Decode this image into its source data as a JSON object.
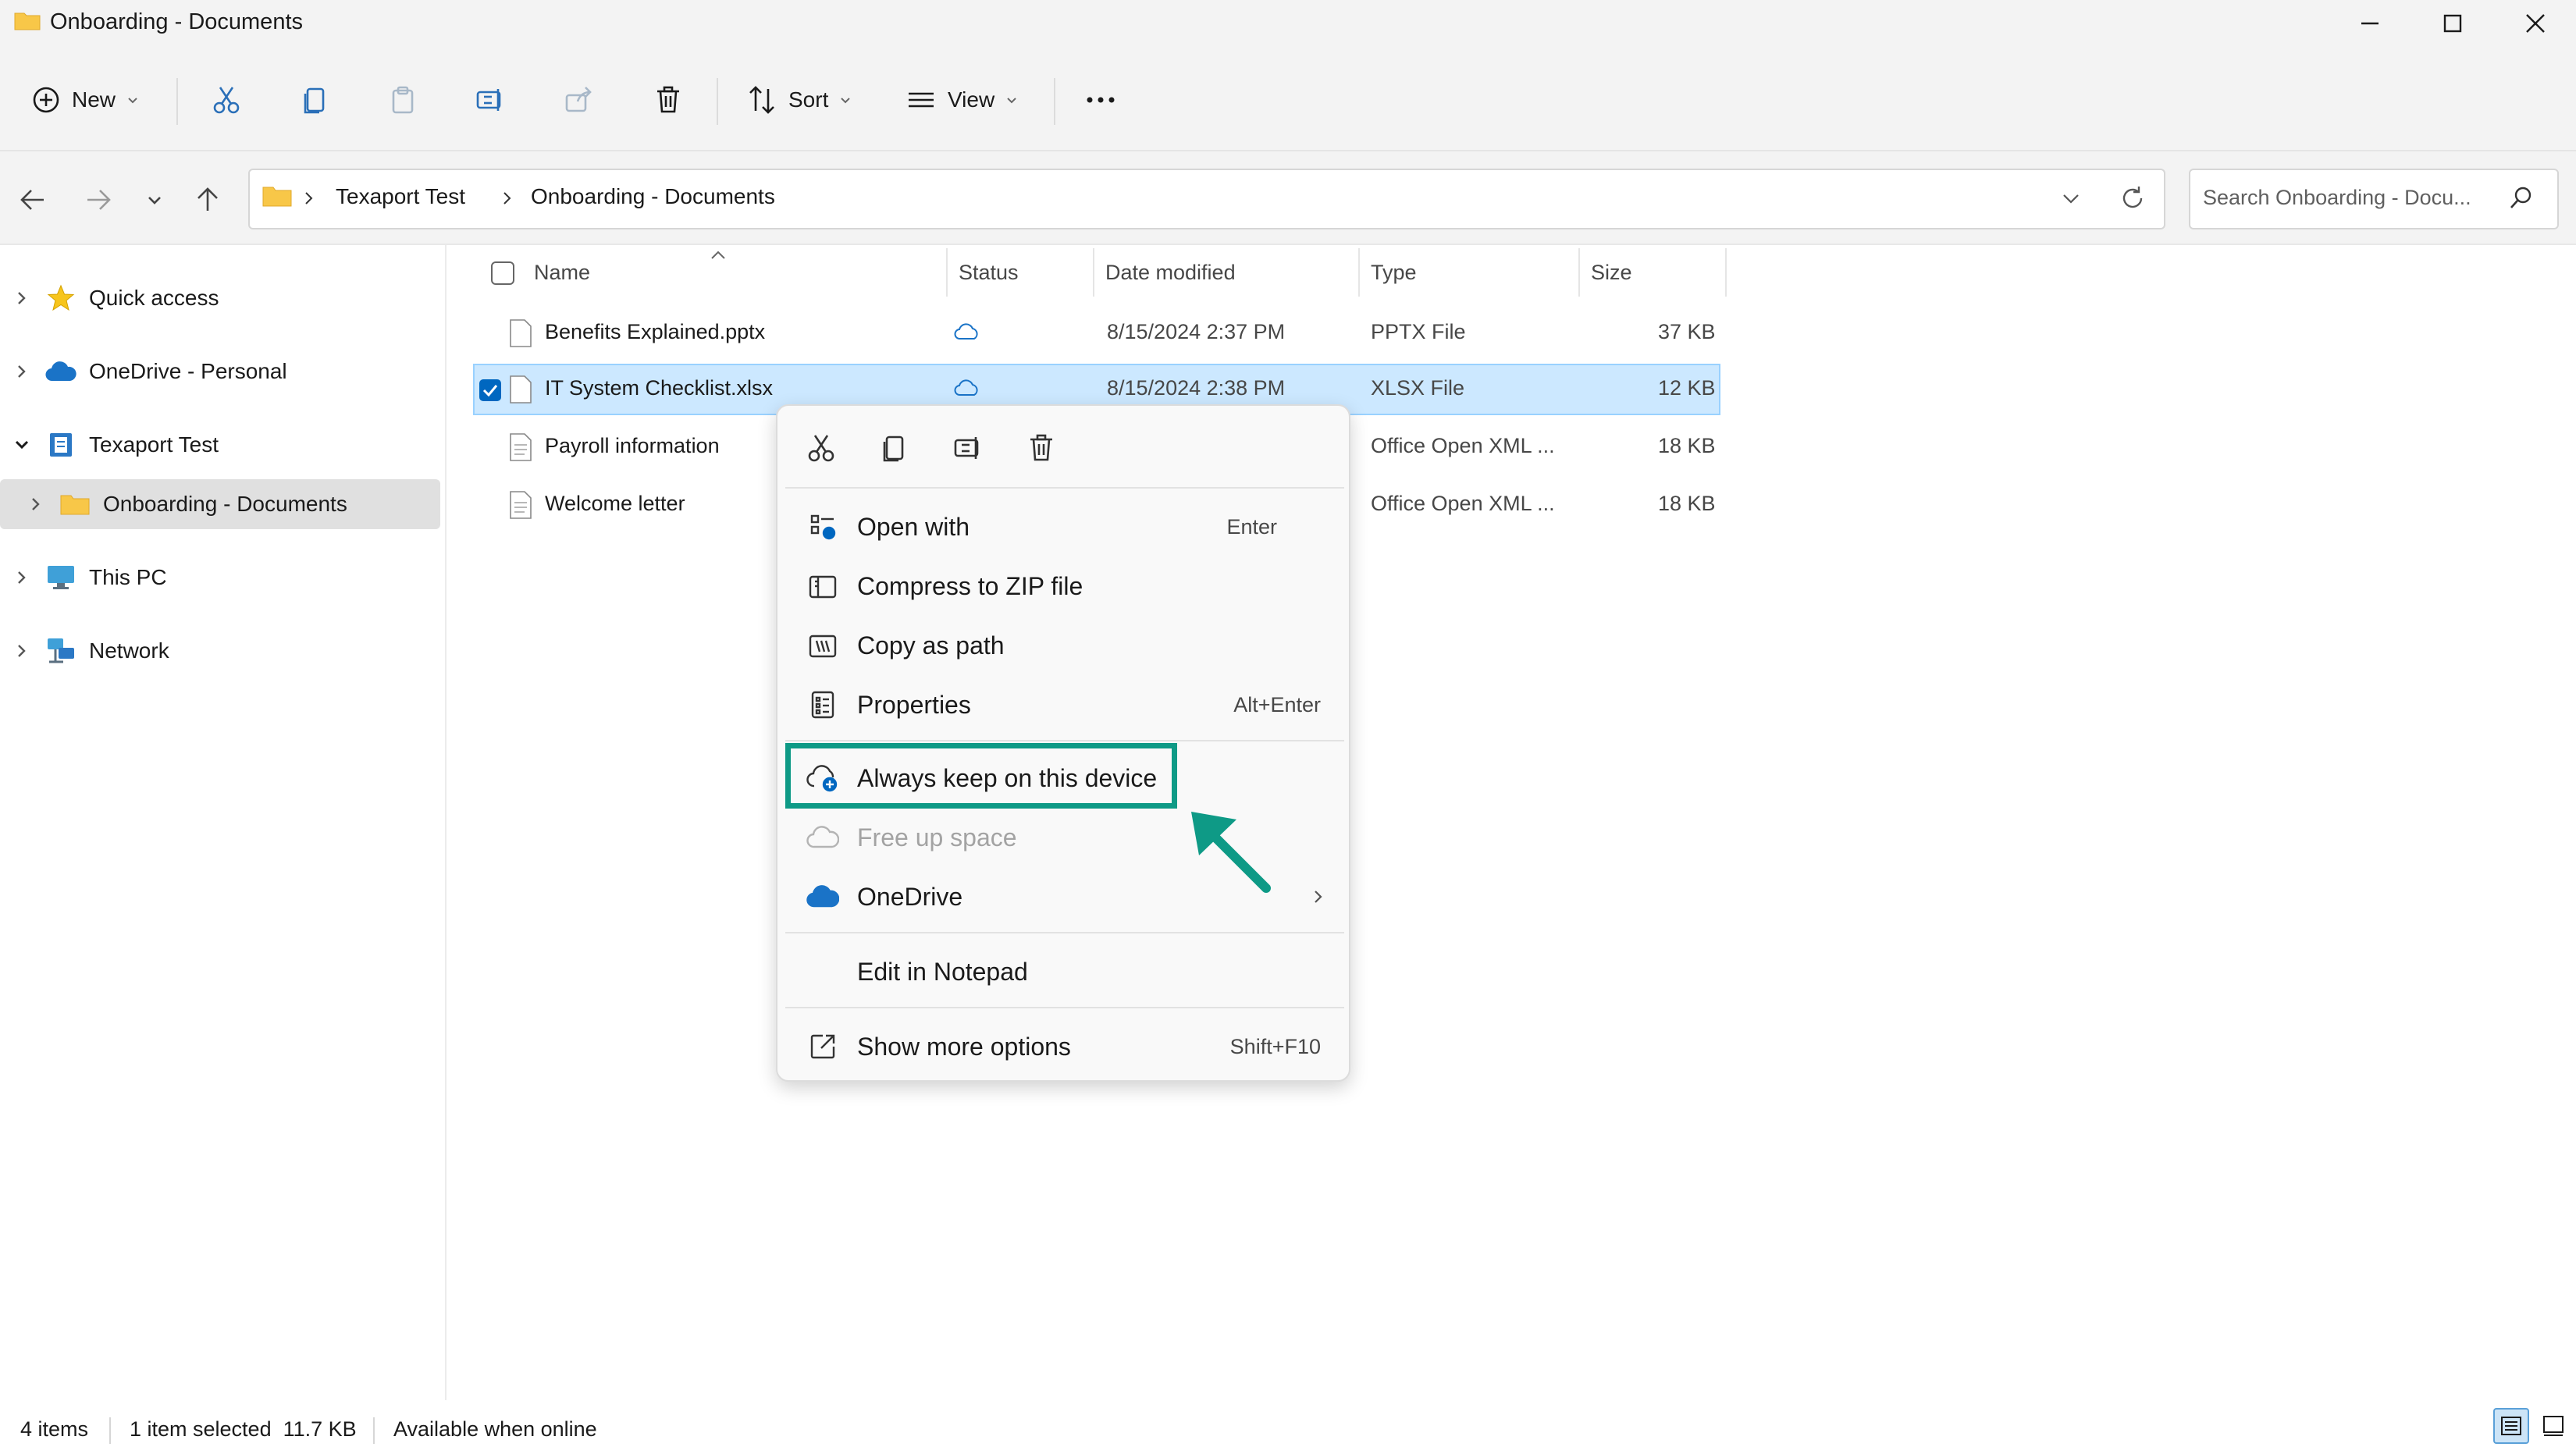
{
  "window": {
    "title": "Onboarding - Documents"
  },
  "toolbar": {
    "new_label": "New",
    "sort_label": "Sort",
    "view_label": "View"
  },
  "address": {
    "crumbs": [
      "Texaport Test",
      "Onboarding - Documents"
    ],
    "search_placeholder": "Search Onboarding - Docu..."
  },
  "sidebar": {
    "items": [
      {
        "label": "Quick access",
        "icon": "star-icon"
      },
      {
        "label": "OneDrive - Personal",
        "icon": "cloud-icon"
      },
      {
        "label": "Texaport Test",
        "icon": "library-icon"
      },
      {
        "label": "Onboarding - Documents",
        "icon": "folder-icon"
      },
      {
        "label": "This PC",
        "icon": "computer-icon"
      },
      {
        "label": "Network",
        "icon": "network-icon"
      }
    ]
  },
  "columns": [
    "Name",
    "Status",
    "Date modified",
    "Type",
    "Size"
  ],
  "files": [
    {
      "name": "Benefits Explained.pptx",
      "date": "8/15/2024 2:37 PM",
      "type": "PPTX File",
      "size": "37 KB",
      "status_icon": "cloud-icon"
    },
    {
      "name": "IT System Checklist.xlsx",
      "date": "8/15/2024 2:38 PM",
      "type": "XLSX File",
      "size": "12 KB",
      "status_icon": "cloud-icon",
      "selected": true
    },
    {
      "name": "Payroll information",
      "date": "",
      "type": "Office Open XML ...",
      "size": "18 KB"
    },
    {
      "name": "Welcome letter",
      "date": "",
      "type": "Office Open XML ...",
      "size": "18 KB"
    }
  ],
  "context_menu": {
    "items": [
      {
        "label": "Open with",
        "accel": "Enter",
        "icon": "open-with-icon"
      },
      {
        "label": "Compress to ZIP file",
        "accel": "",
        "icon": "zip-icon"
      },
      {
        "label": "Copy as path",
        "accel": "",
        "icon": "copy-path-icon"
      },
      {
        "label": "Properties",
        "accel": "Alt+Enter",
        "icon": "properties-icon"
      },
      {
        "label": "Always keep on this device",
        "accel": "",
        "icon": "cloud-keep-icon"
      },
      {
        "label": "Free up space",
        "accel": "",
        "icon": "cloud-icon",
        "disabled": true
      },
      {
        "label": "OneDrive",
        "accel": "",
        "icon": "onedrive-icon",
        "submenu": true
      },
      {
        "label": "Edit in Notepad",
        "accel": "",
        "icon": ""
      },
      {
        "label": "Show more options",
        "accel": "Shift+F10",
        "icon": "more-options-icon"
      }
    ]
  },
  "status_bar": {
    "item_count": "4 items",
    "selection": "1 item selected  11.7 KB",
    "availability": "Available when online"
  },
  "colors": {
    "highlight": "#0e9a86",
    "selection": "#cce8ff",
    "folder": "#f8c748",
    "onedrive": "#1a73c7"
  }
}
